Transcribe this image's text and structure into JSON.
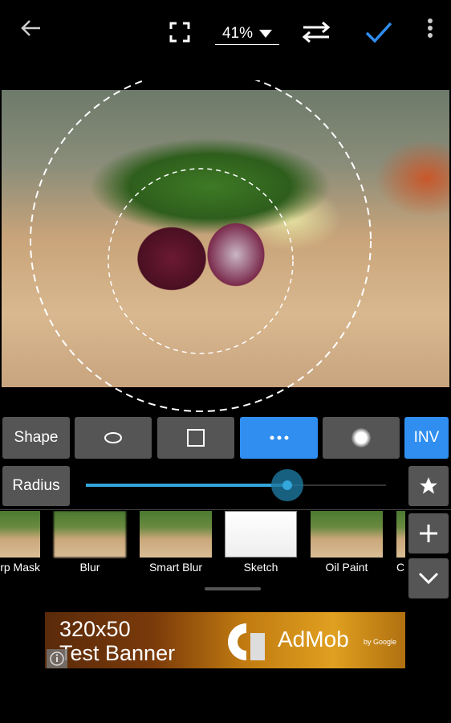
{
  "toolbar": {
    "zoom_level": "41%",
    "icons": [
      "arrow-left-icon",
      "fullscreen-icon",
      "caret-down-icon",
      "swap-icon",
      "check-icon",
      "more-vert-icon"
    ]
  },
  "shape_row": {
    "label": "Shape",
    "shapes": [
      "ellipse",
      "square",
      "dots",
      "soft-circle"
    ],
    "selected": "dots",
    "inv_label": "INV"
  },
  "radius": {
    "label": "Radius",
    "value_fraction": 0.67
  },
  "filters": [
    {
      "label": "rp Mask"
    },
    {
      "label": "Blur"
    },
    {
      "label": "Smart Blur"
    },
    {
      "label": "Sketch"
    },
    {
      "label": "Oil Paint"
    },
    {
      "label": "C"
    }
  ],
  "ad": {
    "line1": "320x50",
    "line2": "Test Banner",
    "brand": "AdMob",
    "by": "by Google"
  },
  "colors": {
    "accent": "#2f8ef0",
    "slider": "#33a6db",
    "button": "#555555"
  }
}
